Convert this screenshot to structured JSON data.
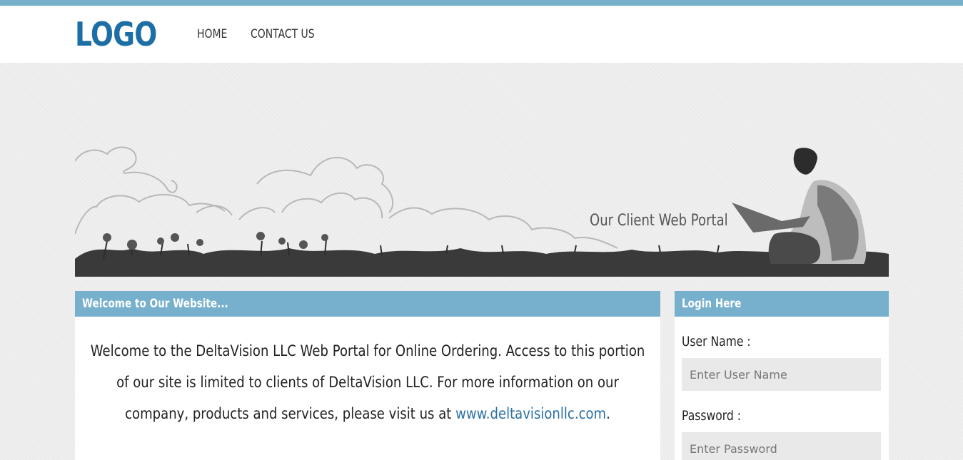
{
  "header": {
    "logo": "LOGO",
    "nav": [
      "HOME",
      "CONTACT US"
    ]
  },
  "banner": {
    "caption": "Our Client Web Portal"
  },
  "welcome": {
    "title": "Welcome to Our Website...",
    "paragraph_before_link": "Welcome to the DeltaVision LLC Web Portal for Online Ordering. Access to this portion of our site is limited to clients of DeltaVision LLC. For more information on our company, products and services, please visit us at ",
    "link_text": "www.deltavisionllc.com",
    "paragraph_after_link": "."
  },
  "login": {
    "title": "Login Here",
    "username_label": "User Name :",
    "username_placeholder": "Enter User Name",
    "password_label": "Password :",
    "password_placeholder": "Enter Password"
  },
  "colors": {
    "accent": "#76b0cd",
    "logo": "#1c6fa5",
    "link": "#2a6fa6"
  }
}
